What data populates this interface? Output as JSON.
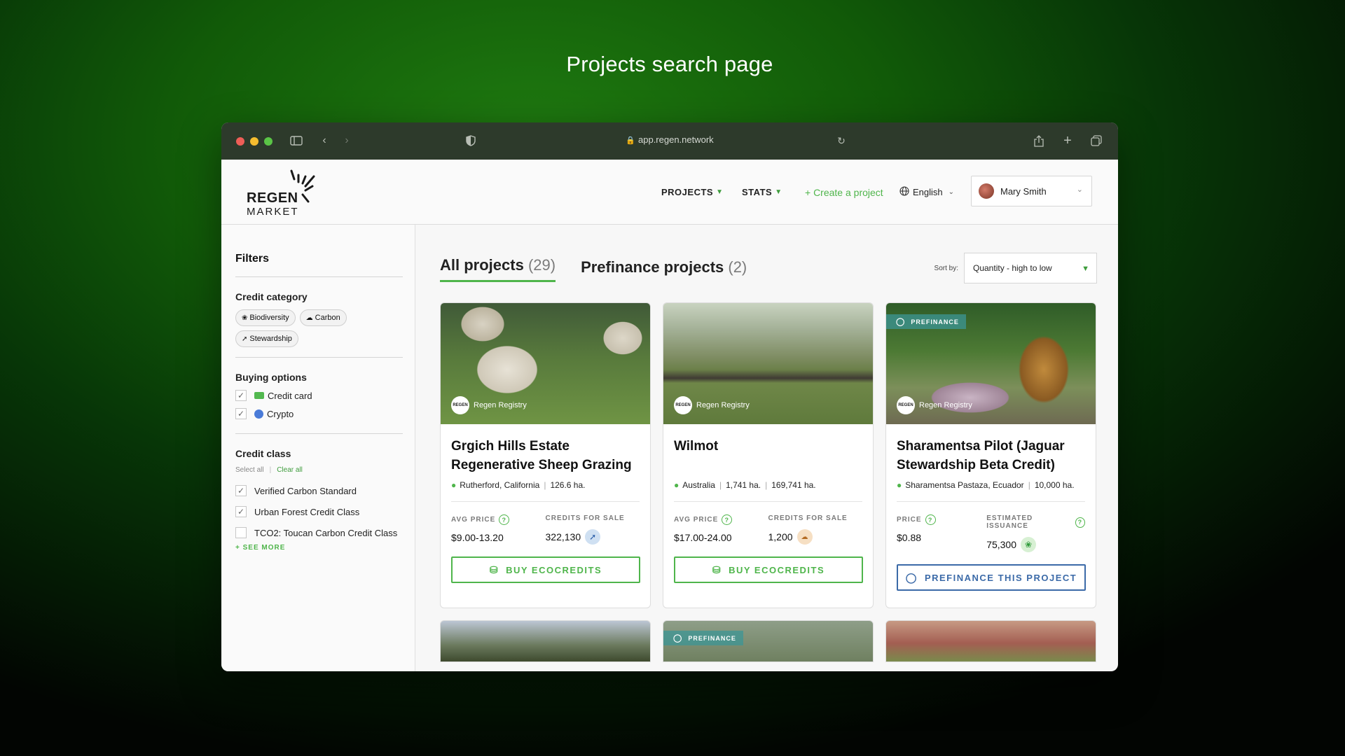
{
  "headline": "Projects search page",
  "browser": {
    "url": "app.regen.network"
  },
  "header": {
    "logo_line1": "REGEN",
    "logo_line2": "MARKET",
    "nav": {
      "projects": "PROJECTS",
      "stats": "STATS",
      "create": "+ Create a project",
      "language": "English"
    },
    "user_name": "Mary Smith"
  },
  "sidebar": {
    "title": "Filters",
    "credit_category": {
      "title": "Credit category",
      "chips": [
        "Biodiversity",
        "Carbon",
        "Stewardship"
      ]
    },
    "buying_options": {
      "title": "Buying options",
      "items": [
        {
          "label": "Credit card",
          "checked": true
        },
        {
          "label": "Crypto",
          "checked": true
        }
      ]
    },
    "credit_class": {
      "title": "Credit class",
      "select_all": "Select all",
      "clear_all": "Clear all",
      "items": [
        {
          "label": "Verified Carbon Standard",
          "checked": true
        },
        {
          "label": "Urban Forest Credit Class",
          "checked": true
        },
        {
          "label": "TCO2: Toucan Carbon Credit Class",
          "checked": false
        }
      ],
      "see_more": "+ SEE MORE"
    }
  },
  "main": {
    "tabs": [
      {
        "label": "All projects",
        "count": "(29)",
        "active": true
      },
      {
        "label": "Prefinance projects",
        "count": "(2)",
        "active": false
      }
    ],
    "sort_label": "Sort by:",
    "sort_value": "Quantity - high to low",
    "cards": [
      {
        "title": "Grgich Hills Estate Regenerative Sheep Grazing",
        "registry": "Regen Registry",
        "location": "Rutherford, California",
        "areas": [
          "126.6 ha."
        ],
        "stat1_label": "AVG PRICE",
        "stat1_value": "$9.00-13.20",
        "stat2_label": "CREDITS FOR SALE",
        "stat2_value": "322,130",
        "credit_icon": "stewardship-icon",
        "button": "BUY ECOCREDITS",
        "prefinance": false
      },
      {
        "title": "Wilmot",
        "registry": "Regen Registry",
        "location": "Australia",
        "areas": [
          "1,741 ha.",
          "169,741 ha."
        ],
        "stat1_label": "AVG PRICE",
        "stat1_value": "$17.00-24.00",
        "stat2_label": "CREDITS FOR SALE",
        "stat2_value": "1,200",
        "credit_icon": "carbon-icon",
        "button": "BUY ECOCREDITS",
        "prefinance": false
      },
      {
        "title": "Sharamentsa Pilot (Jaguar Stewardship Beta Credit)",
        "registry": "Regen Registry",
        "location": "Sharamentsa Pastaza, Ecuador",
        "areas": [
          "10,000 ha."
        ],
        "stat1_label": "PRICE",
        "stat1_value": "$0.88",
        "stat2_label": "ESTIMATED ISSUANCE",
        "stat2_value": "75,300",
        "credit_icon": "biodiversity-icon",
        "button": "PREFINANCE THIS PROJECT",
        "prefinance": true,
        "badge": "PREFINANCE"
      }
    ],
    "row2_badge": "PREFINANCE"
  }
}
